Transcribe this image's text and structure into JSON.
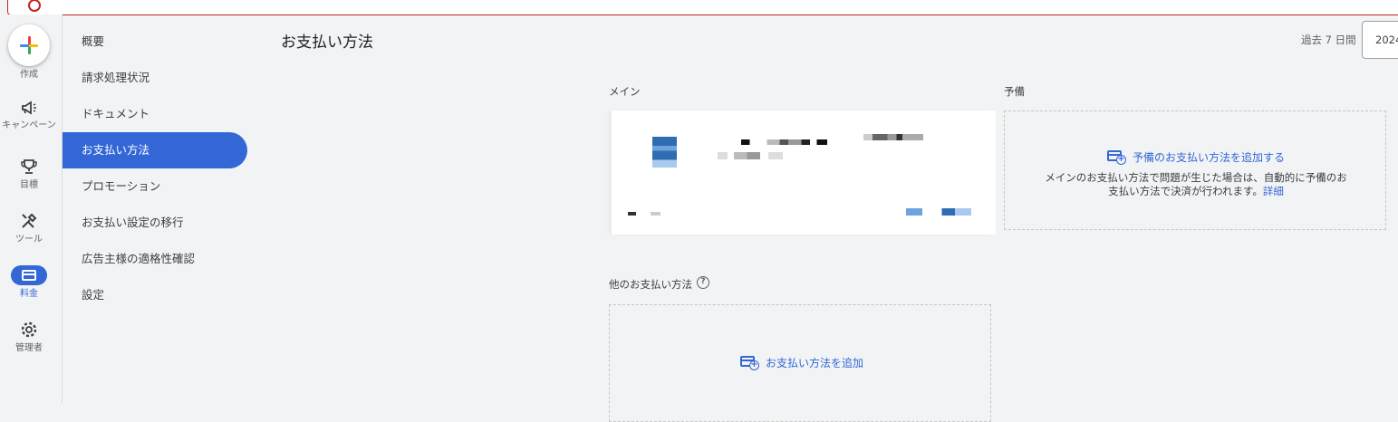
{
  "rail": {
    "create_label": "作成",
    "items": [
      {
        "label": "キャンペーン",
        "icon": "megaphone-icon"
      },
      {
        "label": "目標",
        "icon": "trophy-icon"
      },
      {
        "label": "ツール",
        "icon": "tools-icon"
      },
      {
        "label": "料金",
        "icon": "billing-card-icon"
      },
      {
        "label": "管理者",
        "icon": "gear-icon"
      }
    ]
  },
  "nav": {
    "items": [
      {
        "label": "概要"
      },
      {
        "label": "請求処理状況"
      },
      {
        "label": "ドキュメント"
      },
      {
        "label": "お支払い方法",
        "active": true
      },
      {
        "label": "プロモーション"
      },
      {
        "label": "お支払い設定の移行"
      },
      {
        "label": "広告主様の適格性確認"
      },
      {
        "label": "設定"
      }
    ]
  },
  "header": {
    "title": "お支払い方法",
    "range_label": "過去 7 日間",
    "date_value": "2024"
  },
  "main": {
    "primary_label": "メイン",
    "backup_label": "予備",
    "backup_add_label": "予備のお支払い方法を追加する",
    "backup_desc_line1": "メインのお支払い方法で問題が生じた場合は、自動的に予備のお",
    "backup_desc_line2": "支払い方法で決済が行われます。",
    "backup_desc_link": "詳細",
    "other_label": "他のお支払い方法",
    "other_add_label": "お支払い方法を追加"
  },
  "colors": {
    "accent": "#3367d6",
    "error": "#c5221f",
    "background": "#f1f3f4"
  }
}
